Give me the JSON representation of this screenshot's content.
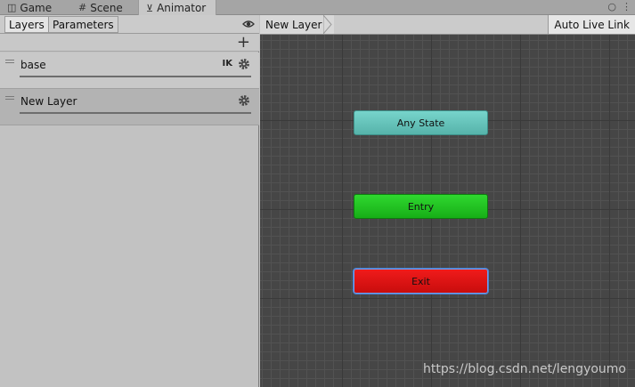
{
  "tabs": [
    {
      "label": "Game",
      "icon": "gamepad-icon"
    },
    {
      "label": "Scene",
      "icon": "grid-icon"
    },
    {
      "label": "Animator",
      "icon": "animator-icon",
      "active": true
    }
  ],
  "left_panel": {
    "subtabs": [
      {
        "label": "Layers",
        "active": true
      },
      {
        "label": "Parameters"
      }
    ],
    "layers": [
      {
        "name": "base",
        "badge": "IK"
      },
      {
        "name": "New Layer",
        "badge": ""
      }
    ]
  },
  "graph": {
    "breadcrumb": "New Layer",
    "auto_live_link": "Auto Live Link",
    "nodes": {
      "any_state": "Any State",
      "entry": "Entry",
      "exit": "Exit"
    },
    "colors": {
      "any_state": "#66c4bb",
      "entry": "#21c421",
      "exit": "#dc1414",
      "background": "#464646"
    }
  },
  "watermark": "https://blog.csdn.net/lengyoumo"
}
